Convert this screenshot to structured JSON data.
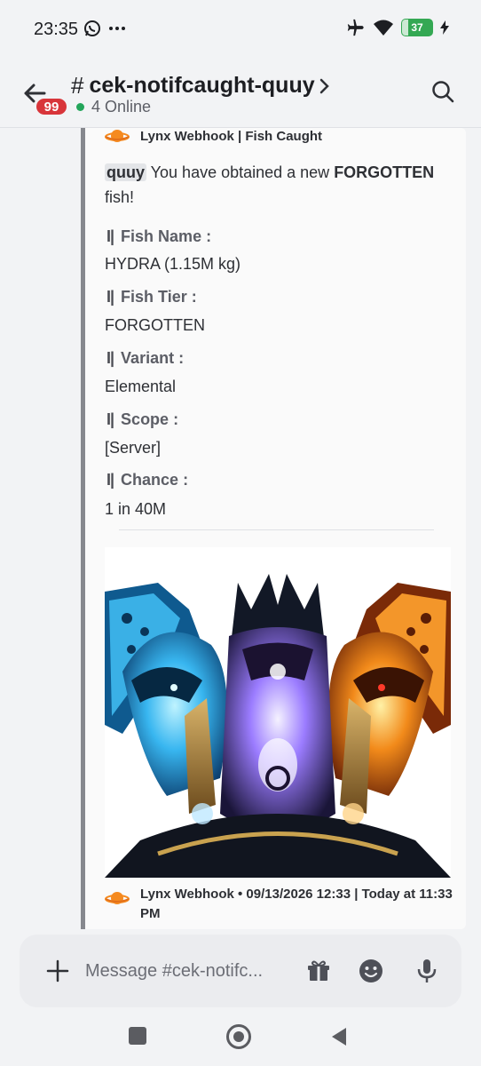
{
  "status_bar": {
    "time": "23:35",
    "battery": "37"
  },
  "header": {
    "channel_name": "cek-notifcaught-quuy",
    "hash": "#",
    "unread_badge": "99",
    "online": "4 Online"
  },
  "embed": {
    "author": "Lynx Webhook | Fish Caught",
    "description": {
      "mention": "quuy",
      "text_before": " You have obtained a new ",
      "tier_bold": "FORGOTTEN",
      "text_after": " fish!"
    },
    "fields": [
      {
        "label": "Fish Name :",
        "value": "HYDRA (1.15M kg)"
      },
      {
        "label": "Fish Tier :",
        "value": "FORGOTTEN"
      },
      {
        "label": "Variant :",
        "value": "Elemental"
      },
      {
        "label": "Scope :",
        "value": "[Server]"
      },
      {
        "label": "Chance :",
        "value": "1 in 40M"
      }
    ],
    "field_prefix": "I|",
    "footer": "Lynx Webhook • 09/13/2026 12:33 | Today at 11:33 PM"
  },
  "composer": {
    "placeholder": "Message #cek-notifc..."
  },
  "colors": {
    "badge": "#d8353a",
    "online_dot": "#23a55a",
    "embed_border": "#86888e",
    "battery": "#34a853"
  },
  "icons": [
    "back-arrow-icon",
    "search-icon",
    "planet-icon",
    "plus-icon",
    "gift-icon",
    "emoji-icon",
    "mic-icon"
  ]
}
